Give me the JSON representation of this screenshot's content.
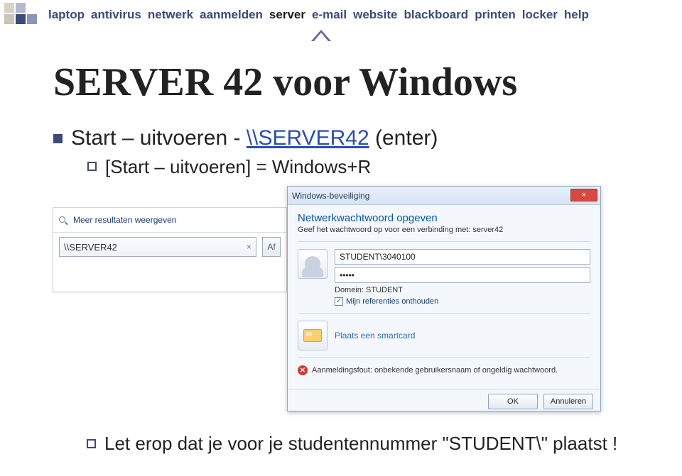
{
  "nav": {
    "items": [
      "laptop",
      "antivirus",
      "netwerk",
      "aanmelden",
      "server",
      "e-mail",
      "website",
      "blackboard",
      "printen",
      "locker",
      "help"
    ],
    "active_index": 4
  },
  "slide": {
    "title": "SERVER 42 voor Windows",
    "bullet1_pre": "Start – uitvoeren - ",
    "bullet1_link": "\\\\SERVER42",
    "bullet1_post": " (enter)",
    "bullet2": "[Start – uitvoeren] = Windows+R",
    "bottom": "Let erop dat je voor je studentennummer \"STUDENT\\\" plaatst !"
  },
  "search": {
    "more_results": "Meer resultaten weergeven",
    "value": "\\\\SERVER42",
    "clear": "×",
    "button_label": "Af"
  },
  "cred": {
    "window_title": "Windows-beveiliging",
    "heading": "Netwerkwachtwoord opgeven",
    "subheading": "Geef het wachtwoord op voor een verbinding met: server42",
    "username": "STUDENT\\3040100",
    "password_mask": "•••••",
    "domain_label": "Domein: STUDENT",
    "remember_label": "Mijn referenties onthouden",
    "remember_checked": "✓",
    "smartcard_label": "Plaats een smartcard",
    "error_text": "Aanmeldingsfout: onbekende gebruikersnaam of ongeldig wachtwoord.",
    "ok": "OK",
    "cancel": "Annuleren",
    "close": "×"
  }
}
